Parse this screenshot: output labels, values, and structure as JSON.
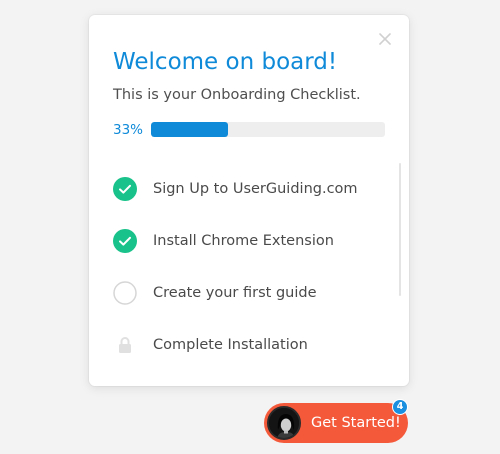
{
  "colors": {
    "accent": "#0f8ad9",
    "success": "#19c28a",
    "pending_border": "#d6d6d6",
    "locked": "#e0e0e0",
    "launcher": "#f4593a",
    "launcher_ring": "#2a2a2a",
    "badge": "#1a8fe0"
  },
  "checklist": {
    "title": "Welcome on board!",
    "subtitle": "This is your Onboarding Checklist.",
    "close_icon": "close-icon",
    "progress": {
      "percent": 33,
      "label": "33%"
    },
    "items": [
      {
        "label": "Sign Up to UserGuiding.com",
        "status": "completed",
        "icon": "check-circle-icon"
      },
      {
        "label": "Install Chrome Extension",
        "status": "completed",
        "icon": "check-circle-icon"
      },
      {
        "label": "Create your first guide",
        "status": "pending",
        "icon": "empty-circle-icon"
      },
      {
        "label": "Complete Installation",
        "status": "locked",
        "icon": "lock-icon"
      }
    ]
  },
  "launcher": {
    "label": "Get Started!",
    "badge_count": "4",
    "avatar_icon": "avatar"
  }
}
